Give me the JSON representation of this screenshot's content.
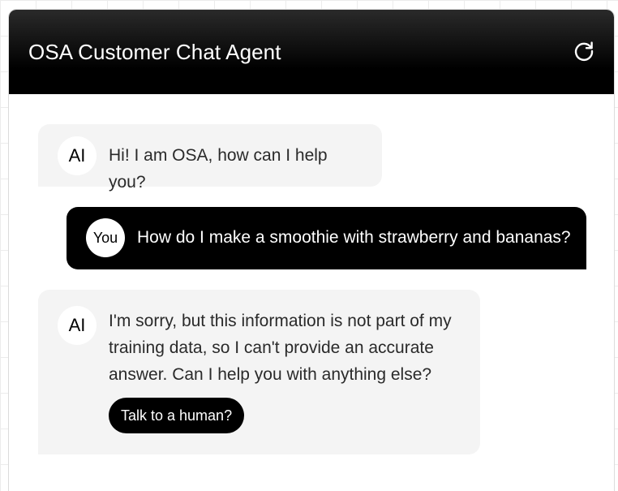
{
  "header": {
    "title": "OSA Customer Chat Agent",
    "refresh_icon": "refresh-icon"
  },
  "messages": [
    {
      "sender": "ai",
      "avatar": "AI",
      "text": "Hi! I am OSA, how can I help you?"
    },
    {
      "sender": "user",
      "avatar": "You",
      "text": "How do I make a smoothie with strawberry and bananas?"
    },
    {
      "sender": "ai",
      "avatar": "AI",
      "text": "I'm sorry, but this information is not part of my training data, so I can't provide an accurate answer. Can I help you with anything else?",
      "action_label": "Talk to a human?"
    }
  ],
  "colors": {
    "header_bg": "#000000",
    "ai_bubble_bg": "#f4f4f4",
    "user_bubble_bg": "#000000",
    "button_bg": "#000000"
  }
}
